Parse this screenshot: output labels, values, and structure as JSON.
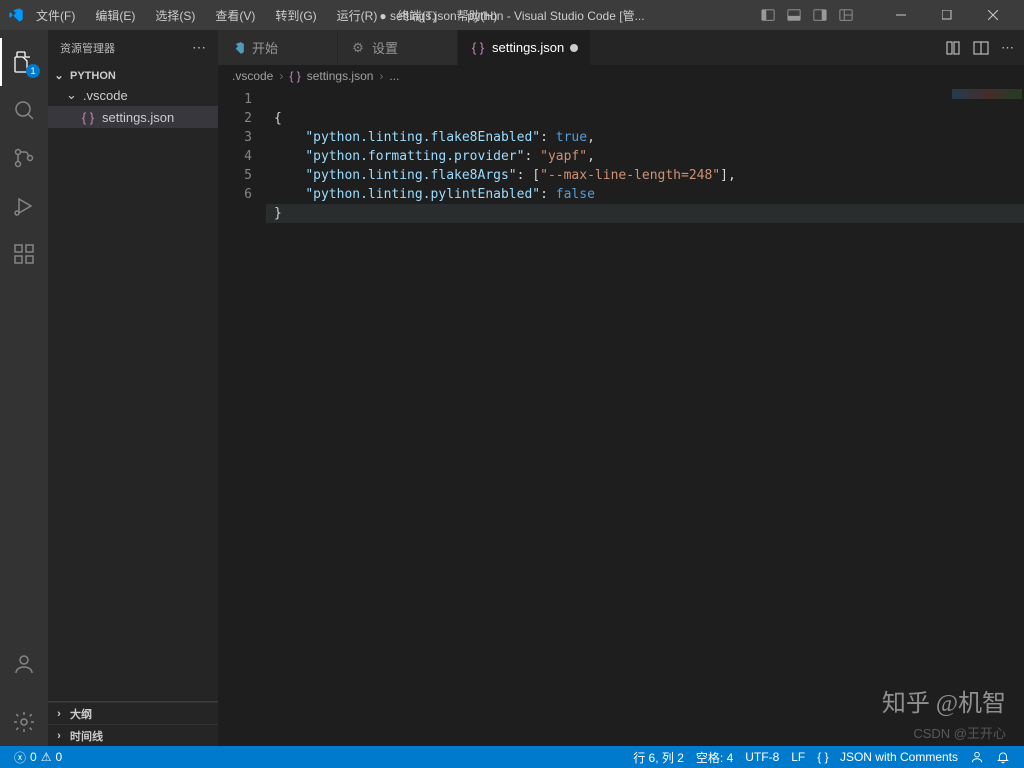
{
  "title": "● settings.json - python - Visual Studio Code [管...",
  "menus": [
    "文件(F)",
    "编辑(E)",
    "选择(S)",
    "查看(V)",
    "转到(G)",
    "运行(R)",
    "终端(T)",
    "帮助(H)"
  ],
  "activity": {
    "explorer_badge": "1"
  },
  "sidebar": {
    "title": "资源管理器",
    "project": "PYTHON",
    "folder": ".vscode",
    "file": "settings.json",
    "outline": "大纲",
    "timeline": "时间线"
  },
  "tabs": {
    "t1": "开始",
    "t2": "设置",
    "t3": "settings.json"
  },
  "breadcrumbs": {
    "c1": ".vscode",
    "c2": "settings.json",
    "dots": "..."
  },
  "code": {
    "lines": [
      "1",
      "2",
      "3",
      "4",
      "5",
      "6"
    ],
    "l1": "{",
    "l2_k": "\"python.linting.flake8Enabled\"",
    "l2_c": ": ",
    "l2_v": "true",
    "l2_e": ",",
    "l3_k": "\"python.formatting.provider\"",
    "l3_c": ": ",
    "l3_v": "\"yapf\"",
    "l3_e": ",",
    "l4_k": "\"python.linting.flake8Args\"",
    "l4_c": ": [",
    "l4_v": "\"--max-line-length=248\"",
    "l4_e": "],",
    "l5_k": "\"python.linting.pylintEnabled\"",
    "l5_c": ": ",
    "l5_v": "false",
    "l6": "}"
  },
  "status": {
    "errors": "0",
    "warnings": "0",
    "ln_col": "行 6, 列 2",
    "spaces": "空格: 4",
    "encoding": "UTF-8",
    "eol": "LF",
    "lang": "JSON with Comments",
    "lang_icon": "{ }"
  },
  "watermark": "知乎 @机智",
  "watermark2": "CSDN @王开心"
}
